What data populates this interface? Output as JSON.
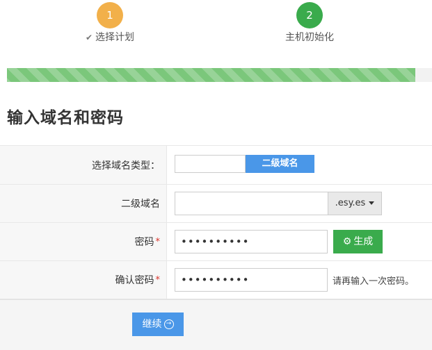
{
  "steps": [
    {
      "number": "1",
      "label": "选择计划",
      "color": "#f2b04a",
      "check": "✔"
    },
    {
      "number": "2",
      "label": "主机初始化",
      "color": "#3aab4c"
    }
  ],
  "progress": {
    "percent": 96
  },
  "section_title": "输入域名和密码",
  "form": {
    "domain_type": {
      "label": "选择域名类型：",
      "option_active": "二级域名"
    },
    "subdomain": {
      "label": "二级域名",
      "value": "",
      "suffix": ".esy.es"
    },
    "password": {
      "label": "密码",
      "required_mark": "*",
      "value": "••••••••••",
      "generate_label": "生成"
    },
    "confirm": {
      "label": "确认密码",
      "required_mark": "*",
      "value": "••••••••••",
      "hint": "请再输入一次密码。"
    }
  },
  "footer": {
    "continue_label": "继续"
  }
}
